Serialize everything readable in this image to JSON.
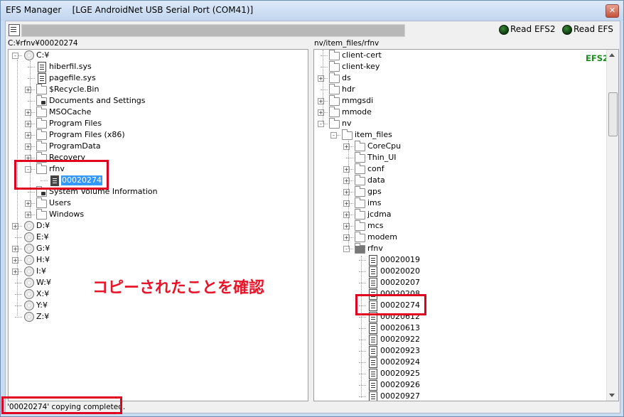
{
  "window": {
    "title": "EFS Manager    [LGE AndroidNet USB Serial Port (COM41)]",
    "close_glyph": "✕"
  },
  "toolbar": {
    "read_efs2": "Read EFS2",
    "read_efs": "Read EFS",
    "led_color": "#1e6a1e"
  },
  "left_pane": {
    "path": "C:¥rfnv¥00020274",
    "nodes": [
      {
        "label": "C:¥",
        "icon": "drive",
        "depth": 0,
        "exp": "-"
      },
      {
        "label": "hiberfil.sys",
        "icon": "file",
        "depth": 1,
        "exp": ""
      },
      {
        "label": "pagefile.sys",
        "icon": "file",
        "depth": 1,
        "exp": ""
      },
      {
        "label": "$Recycle.Bin",
        "icon": "folder",
        "depth": 1,
        "exp": "+"
      },
      {
        "label": "Documents and Settings",
        "icon": "folder-lock",
        "depth": 1,
        "exp": ""
      },
      {
        "label": "MSOCache",
        "icon": "folder",
        "depth": 1,
        "exp": "+"
      },
      {
        "label": "Program Files",
        "icon": "folder",
        "depth": 1,
        "exp": "+"
      },
      {
        "label": "Program Files (x86)",
        "icon": "folder",
        "depth": 1,
        "exp": "+"
      },
      {
        "label": "ProgramData",
        "icon": "folder",
        "depth": 1,
        "exp": "+"
      },
      {
        "label": "Recovery",
        "icon": "folder",
        "depth": 1,
        "exp": "+"
      },
      {
        "label": "rfnv",
        "icon": "folder",
        "depth": 1,
        "exp": "-"
      },
      {
        "label": "00020274",
        "icon": "file-dark",
        "depth": 2,
        "exp": "",
        "selected": true
      },
      {
        "label": "System Volume Information",
        "icon": "folder-lock",
        "depth": 1,
        "exp": ""
      },
      {
        "label": "Users",
        "icon": "folder",
        "depth": 1,
        "exp": "+"
      },
      {
        "label": "Windows",
        "icon": "folder",
        "depth": 1,
        "exp": "+"
      },
      {
        "label": "D:¥",
        "icon": "drive",
        "depth": 0,
        "exp": "+"
      },
      {
        "label": "E:¥",
        "icon": "drive",
        "depth": 0,
        "exp": ""
      },
      {
        "label": "G:¥",
        "icon": "drive",
        "depth": 0,
        "exp": "+"
      },
      {
        "label": "H:¥",
        "icon": "drive",
        "depth": 0,
        "exp": "+"
      },
      {
        "label": "I:¥",
        "icon": "drive",
        "depth": 0,
        "exp": "+"
      },
      {
        "label": "W:¥",
        "icon": "drive",
        "depth": 0,
        "exp": ""
      },
      {
        "label": "X:¥",
        "icon": "drive",
        "depth": 0,
        "exp": ""
      },
      {
        "label": "Y:¥",
        "icon": "drive",
        "depth": 0,
        "exp": ""
      },
      {
        "label": "Z:¥",
        "icon": "drive",
        "depth": 0,
        "exp": ""
      }
    ]
  },
  "right_pane": {
    "path": "nv/item_files/rfnv",
    "badge": "EFS2",
    "nodes": [
      {
        "label": "client-cert",
        "icon": "folder",
        "depth": 0,
        "exp": ""
      },
      {
        "label": "client-key",
        "icon": "folder",
        "depth": 0,
        "exp": ""
      },
      {
        "label": "ds",
        "icon": "folder",
        "depth": 0,
        "exp": "+"
      },
      {
        "label": "hdr",
        "icon": "folder",
        "depth": 0,
        "exp": ""
      },
      {
        "label": "mmgsdi",
        "icon": "folder",
        "depth": 0,
        "exp": "+"
      },
      {
        "label": "mmode",
        "icon": "folder",
        "depth": 0,
        "exp": "+"
      },
      {
        "label": "nv",
        "icon": "folder",
        "depth": 0,
        "exp": "-"
      },
      {
        "label": "item_files",
        "icon": "folder",
        "depth": 1,
        "exp": "-"
      },
      {
        "label": "CoreCpu",
        "icon": "folder",
        "depth": 2,
        "exp": "+"
      },
      {
        "label": "Thin_UI",
        "icon": "folder",
        "depth": 2,
        "exp": ""
      },
      {
        "label": "conf",
        "icon": "folder",
        "depth": 2,
        "exp": "+"
      },
      {
        "label": "data",
        "icon": "folder",
        "depth": 2,
        "exp": "+"
      },
      {
        "label": "gps",
        "icon": "folder",
        "depth": 2,
        "exp": "+"
      },
      {
        "label": "ims",
        "icon": "folder",
        "depth": 2,
        "exp": "+"
      },
      {
        "label": "jcdma",
        "icon": "folder",
        "depth": 2,
        "exp": "+"
      },
      {
        "label": "mcs",
        "icon": "folder",
        "depth": 2,
        "exp": "+"
      },
      {
        "label": "modem",
        "icon": "folder",
        "depth": 2,
        "exp": "+"
      },
      {
        "label": "rfnv",
        "icon": "folder-open",
        "depth": 2,
        "exp": "-"
      },
      {
        "label": "00020019",
        "icon": "file",
        "depth": 3,
        "exp": ""
      },
      {
        "label": "00020020",
        "icon": "file",
        "depth": 3,
        "exp": ""
      },
      {
        "label": "00020207",
        "icon": "file",
        "depth": 3,
        "exp": ""
      },
      {
        "label": "00020208",
        "icon": "file",
        "depth": 3,
        "exp": ""
      },
      {
        "label": "00020274",
        "icon": "file",
        "depth": 3,
        "exp": ""
      },
      {
        "label": "00020612",
        "icon": "file",
        "depth": 3,
        "exp": ""
      },
      {
        "label": "00020613",
        "icon": "file",
        "depth": 3,
        "exp": ""
      },
      {
        "label": "00020922",
        "icon": "file",
        "depth": 3,
        "exp": ""
      },
      {
        "label": "00020923",
        "icon": "file",
        "depth": 3,
        "exp": ""
      },
      {
        "label": "00020924",
        "icon": "file",
        "depth": 3,
        "exp": ""
      },
      {
        "label": "00020925",
        "icon": "file",
        "depth": 3,
        "exp": ""
      },
      {
        "label": "00020926",
        "icon": "file",
        "depth": 3,
        "exp": ""
      },
      {
        "label": "00020927",
        "icon": "file",
        "depth": 3,
        "exp": ""
      }
    ]
  },
  "status": {
    "text": "'00020274' copying completed."
  },
  "annotation": {
    "text": "コピーされたことを確認",
    "color": "#e8152a"
  }
}
